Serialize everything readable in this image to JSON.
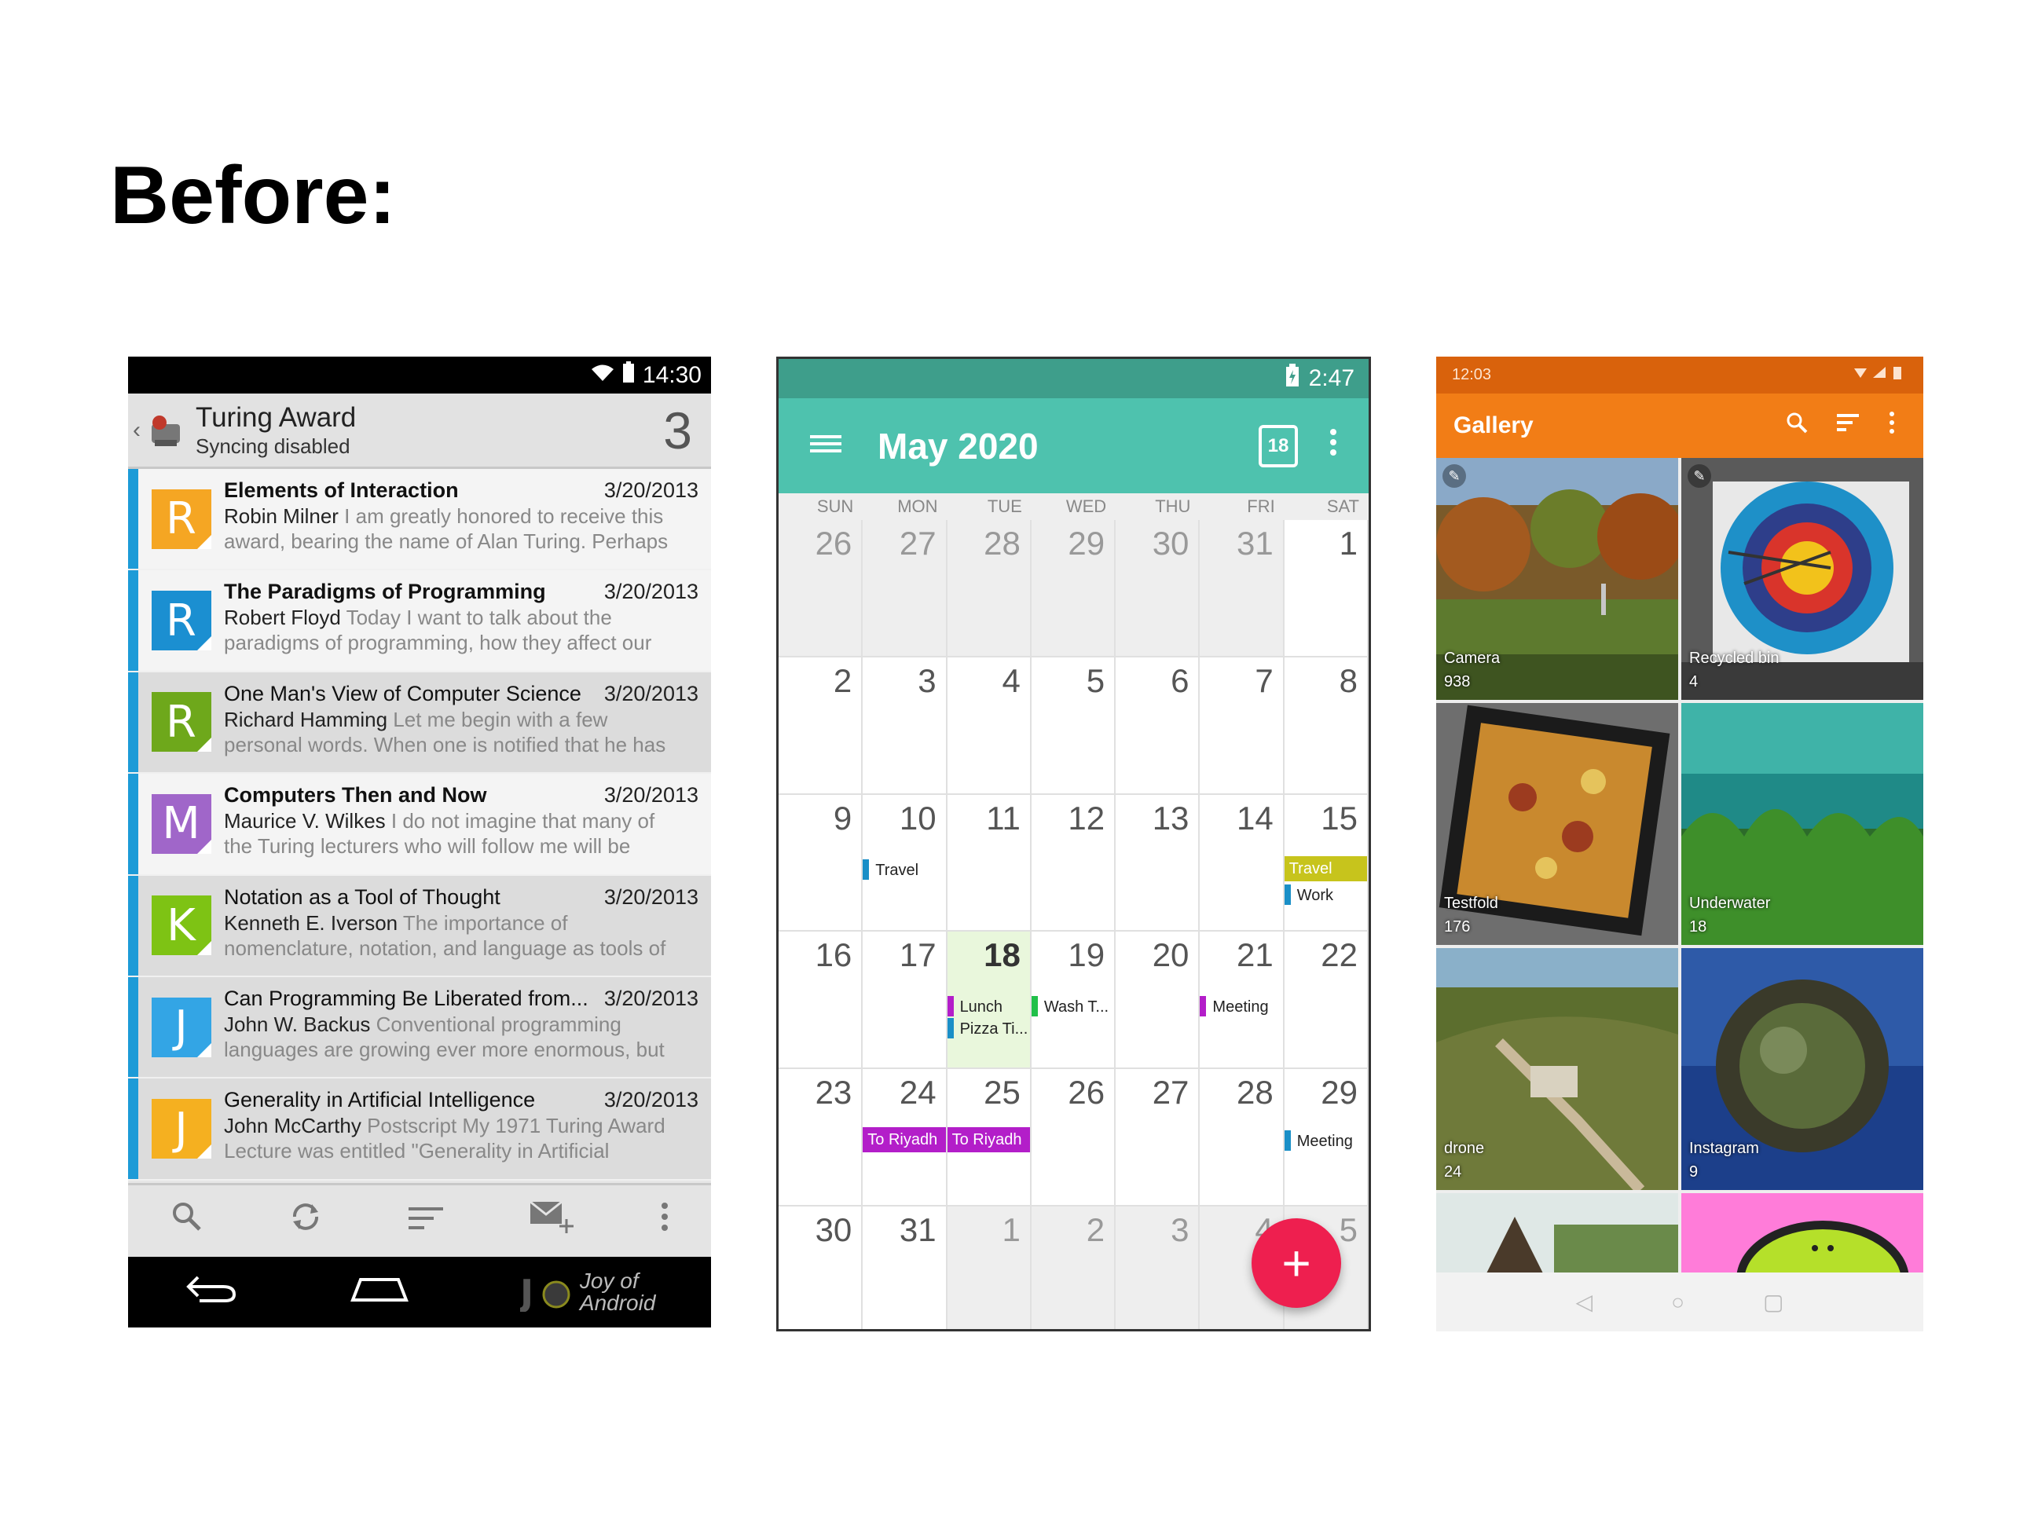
{
  "heading": "Before:",
  "email": {
    "status_time": "14:30",
    "title": "Turing Award",
    "subtitle": "Syncing disabled",
    "count": "3",
    "mails": [
      {
        "subject": "Elements of Interaction",
        "date": "3/20/2013",
        "sender": "Robin Milner",
        "preview1": " I am greatly honored to receive this",
        "preview2": "award, bearing the name of Alan Turing. Perhaps",
        "letter": "R",
        "color": "#f5a623",
        "unread": true
      },
      {
        "subject": "The Paradigms of Programming",
        "date": "3/20/2013",
        "sender": "Robert Floyd",
        "preview1": " Today I want to talk about the",
        "preview2": "paradigms of programming, how they affect our",
        "letter": "R",
        "color": "#1b8fd1",
        "unread": true
      },
      {
        "subject": "One Man's View of Computer Science",
        "date": "3/20/2013",
        "sender": "Richard Hamming",
        "preview1": " Let me begin with a few",
        "preview2": "personal words. When one is notified that he has",
        "letter": "R",
        "color": "#6ea81b",
        "unread": false
      },
      {
        "subject": "Computers Then and Now",
        "date": "3/20/2013",
        "sender": "Maurice V. Wilkes",
        "preview1": " I do not imagine that many of",
        "preview2": "the Turing lecturers who will follow me will be",
        "letter": "M",
        "color": "#a066c9",
        "unread": true
      },
      {
        "subject": "Notation as a Tool of Thought",
        "date": "3/20/2013",
        "sender": "Kenneth E. Iverson",
        "preview1": " The importance of",
        "preview2": "nomenclature, notation, and language as tools of",
        "letter": "K",
        "color": "#7ec314",
        "unread": false
      },
      {
        "subject": "Can Programming Be Liberated from...",
        "date": "3/20/2013",
        "sender": "John W. Backus",
        "preview1": " Conventional programming",
        "preview2": "languages are growing ever more enormous, but",
        "letter": "J",
        "color": "#33a5e5",
        "unread": false
      },
      {
        "subject": "Generality in Artificial Intelligence",
        "date": "3/20/2013",
        "sender": "John McCarthy",
        "preview1": " Postscript My 1971 Turing Award",
        "preview2": "Lecture was entitled \"Generality in Artificial",
        "letter": "J",
        "color": "#f5b020",
        "unread": false
      }
    ],
    "toolbar_icons": [
      "search-icon",
      "refresh-icon",
      "sort-icon",
      "compose-icon",
      "overflow-icon"
    ],
    "watermark1": "Joy of",
    "watermark2": "Android"
  },
  "calendar": {
    "status_time": "2:47",
    "month_title": "May 2020",
    "today_badge": "18",
    "weekdays": [
      "SUN",
      "MON",
      "TUE",
      "WED",
      "THU",
      "FRI",
      "SAT"
    ],
    "days": [
      "26",
      "27",
      "28",
      "29",
      "30",
      "31",
      "1",
      "2",
      "3",
      "4",
      "5",
      "6",
      "7",
      "8",
      "9",
      "10",
      "11",
      "12",
      "13",
      "14",
      "15",
      "16",
      "17",
      "18",
      "19",
      "20",
      "21",
      "22",
      "23",
      "24",
      "25",
      "26",
      "27",
      "28",
      "29",
      "30",
      "31",
      "1",
      "2",
      "3",
      "4",
      "5"
    ],
    "events": {
      "travel_mon": "Travel",
      "travel_sat": "Travel",
      "work_sat": "Work",
      "lunch": "Lunch",
      "pizza": "Pizza Ti...",
      "wash": "Wash T...",
      "meeting_fri": "Meeting",
      "riyadh_mon": "To Riyadh",
      "riyadh_tue": "To Riyadh",
      "meeting_sat": "Meeting"
    },
    "fab_label": "+"
  },
  "gallery": {
    "status_time": "12:03",
    "title": "Gallery",
    "albums": [
      {
        "name": "Camera",
        "count": "938"
      },
      {
        "name": "Recycled bin",
        "count": "4"
      },
      {
        "name": "Testfold",
        "count": "176"
      },
      {
        "name": "Underwater",
        "count": "18"
      },
      {
        "name": "drone",
        "count": "24"
      },
      {
        "name": "Instagram",
        "count": "9"
      }
    ]
  }
}
